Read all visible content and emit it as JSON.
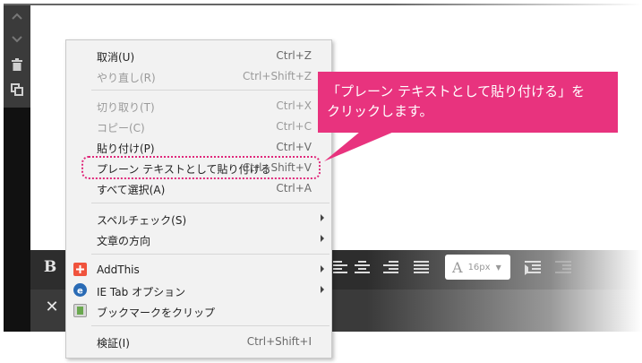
{
  "menu": {
    "items": [
      {
        "label": "取消(U)",
        "shortcut": "Ctrl+Z",
        "disabled": false
      },
      {
        "label": "やり直し(R)",
        "shortcut": "Ctrl+Shift+Z",
        "disabled": true
      },
      {
        "label": "切り取り(T)",
        "shortcut": "Ctrl+X",
        "disabled": true
      },
      {
        "label": "コピー(C)",
        "shortcut": "Ctrl+C",
        "disabled": true
      },
      {
        "label": "貼り付け(P)",
        "shortcut": "Ctrl+V",
        "disabled": false
      },
      {
        "label": "プレーン テキストとして貼り付ける",
        "shortcut": "Ctrl+Shift+V",
        "disabled": false
      },
      {
        "label": "すべて選択(A)",
        "shortcut": "Ctrl+A",
        "disabled": false
      },
      {
        "label": "スペルチェック(S)",
        "shortcut": "",
        "disabled": false
      },
      {
        "label": "文章の方向",
        "shortcut": "",
        "disabled": false
      },
      {
        "label": "AddThis",
        "shortcut": "",
        "disabled": false
      },
      {
        "label": "IE Tab オプション",
        "shortcut": "",
        "disabled": false
      },
      {
        "label": "ブックマークをクリップ",
        "shortcut": "",
        "disabled": false
      },
      {
        "label": "検証(I)",
        "shortcut": "Ctrl+Shift+I",
        "disabled": false
      }
    ]
  },
  "callout": {
    "line1": "「プレーン テキストとして貼り付ける」を",
    "line2": "クリックします。"
  },
  "toolbar": {
    "bold_label": "B",
    "font_size_glyph": "A",
    "font_size_value": "16px",
    "close_label": "✕"
  },
  "icons": {
    "side": [
      "chevron-up-icon",
      "chevron-down-icon",
      "trash-icon",
      "copy-icon"
    ],
    "addthis_color": "#f0533d",
    "ietab_color": "#2a6bb5"
  },
  "colors": {
    "accent": "#e8337e",
    "highlight_border": "#e0287a"
  }
}
